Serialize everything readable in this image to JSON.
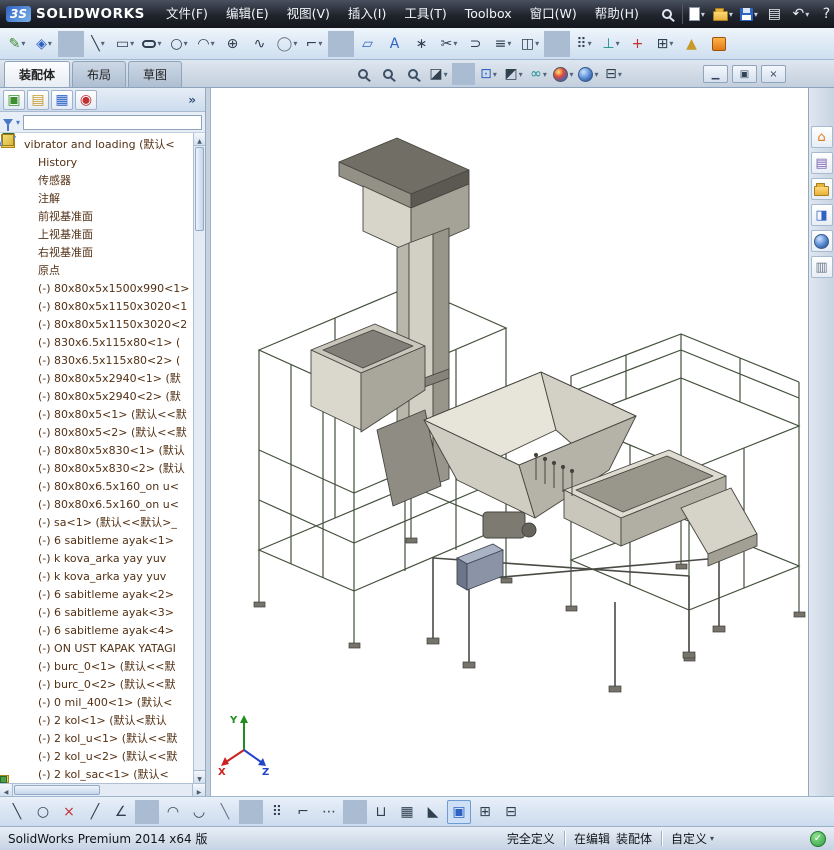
{
  "titlebar": {
    "logo_mark": "3S",
    "logo": "SOLIDWORKS",
    "menus": [
      {
        "label": "文件(F)"
      },
      {
        "label": "编辑(E)"
      },
      {
        "label": "视图(V)"
      },
      {
        "label": "插入(I)"
      },
      {
        "label": "工具(T)"
      },
      {
        "label": "Toolbox"
      },
      {
        "label": "窗口(W)"
      },
      {
        "label": "帮助(H)"
      }
    ],
    "icons": [
      {
        "name": "search-icon",
        "cls": "c-mag",
        "glyph": ""
      },
      {
        "name": "titlebar-separator",
        "cls": "c-sep",
        "glyph": ""
      },
      {
        "name": "new-document-icon",
        "cls": "c-new",
        "glyph": "",
        "dd": "▾"
      },
      {
        "name": "open-icon",
        "cls": "c-folder",
        "glyph": "",
        "dd": "▾"
      },
      {
        "name": "save-icon",
        "cls": "c-save",
        "glyph": "",
        "dd": "▾"
      },
      {
        "name": "print-icon",
        "cls": "g-light",
        "glyph": "▤"
      },
      {
        "name": "undo-icon",
        "cls": "g-light",
        "glyph": "↶",
        "dd": "▾"
      },
      {
        "name": "help-icon",
        "cls": "g-light",
        "glyph": "?"
      },
      {
        "name": "switch-windows-icon",
        "cls": "g-light",
        "glyph": "▣"
      },
      {
        "name": "fullscreen-icon",
        "cls": "g-light",
        "glyph": "⊞"
      },
      {
        "name": "options-icon",
        "cls": "c-orange",
        "glyph": ""
      }
    ]
  },
  "toolbar_sketch": {
    "icons": [
      {
        "name": "edit-sketch-icon",
        "cls": "g-green",
        "glyph": "✎",
        "dd": "▾"
      },
      {
        "name": "smart-dimension-icon",
        "cls": "g-blue",
        "glyph": "◈",
        "dd": "▾"
      },
      {
        "name": "toolbar-separator",
        "cls": "c-sep",
        "glyph": ""
      },
      {
        "name": "line-icon",
        "cls": "g-dark",
        "glyph": "╲",
        "dd": "▾"
      },
      {
        "name": "rectangle-icon",
        "cls": "g-dark",
        "glyph": "▭",
        "dd": "▾"
      },
      {
        "name": "slot-icon",
        "cls": "c-pill",
        "glyph": "",
        "dd": "▾"
      },
      {
        "name": "circle-icon",
        "cls": "g-dark",
        "glyph": "○",
        "dd": "▾"
      },
      {
        "name": "arc-icon",
        "cls": "g-dark",
        "glyph": "◠",
        "dd": "▾"
      },
      {
        "name": "perimeter-circle-icon",
        "cls": "g-dark",
        "glyph": "⊕"
      },
      {
        "name": "spline-icon",
        "cls": "g-dark",
        "glyph": "∿"
      },
      {
        "name": "ellipse-icon",
        "cls": "g-gray",
        "glyph": "◯",
        "dd": "▾"
      },
      {
        "name": "fillet-icon",
        "cls": "g-dark",
        "glyph": "⌐",
        "dd": "▾"
      },
      {
        "name": "toolbar-separator",
        "cls": "c-sep",
        "glyph": ""
      },
      {
        "name": "plane-icon",
        "cls": "g-blue",
        "glyph": "▱"
      },
      {
        "name": "text-icon",
        "cls": "g-blue",
        "glyph": "A"
      },
      {
        "name": "point-icon",
        "cls": "g-dark",
        "glyph": "∗"
      },
      {
        "name": "trim-entities-icon",
        "cls": "g-dark",
        "glyph": "✂",
        "dd": "▾"
      },
      {
        "name": "convert-entities-icon",
        "cls": "g-dark",
        "glyph": "⊃"
      },
      {
        "name": "offset-entities-icon",
        "cls": "g-dark",
        "glyph": "≡",
        "dd": "▾"
      },
      {
        "name": "mirror-entities-icon",
        "cls": "g-dark",
        "glyph": "◫",
        "dd": "▾"
      },
      {
        "name": "toolbar-separator",
        "cls": "c-sep",
        "glyph": ""
      },
      {
        "name": "linear-pattern-icon",
        "cls": "g-dark",
        "glyph": "⠿",
        "dd": "▾"
      },
      {
        "name": "display-relations-icon",
        "cls": "g-teal",
        "glyph": "⊥",
        "dd": "▾"
      },
      {
        "name": "repair-sketch-icon",
        "cls": "g-red",
        "glyph": "+"
      },
      {
        "name": "quick-snaps-icon",
        "cls": "g-dark",
        "glyph": "⊞",
        "dd": "▾"
      },
      {
        "name": "rapid-sketch-icon",
        "cls": "g-gold",
        "glyph": "▲"
      },
      {
        "name": "sketch-options-icon",
        "cls": "c-orange",
        "glyph": ""
      }
    ]
  },
  "tabs": {
    "items": [
      {
        "label": "装配体",
        "state": "active"
      },
      {
        "label": "布局",
        "state": ""
      },
      {
        "label": "草图",
        "state": ""
      }
    ]
  },
  "headsup": {
    "icons": [
      {
        "name": "zoom-fit-icon",
        "cls": "c-mag",
        "glyph": ""
      },
      {
        "name": "zoom-area-icon",
        "cls": "c-mag",
        "glyph": ""
      },
      {
        "name": "previous-view-icon",
        "cls": "c-mag",
        "glyph": ""
      },
      {
        "name": "section-view-icon",
        "cls": "g-dark",
        "glyph": "◪",
        "dd": "▾"
      },
      {
        "name": "headsup-separator",
        "cls": "c-sep",
        "glyph": ""
      },
      {
        "name": "view-orientation-icon",
        "cls": "g-blue",
        "glyph": "⊡",
        "dd": "▾"
      },
      {
        "name": "display-style-icon",
        "cls": "g-dark",
        "glyph": "◩",
        "dd": "▾"
      },
      {
        "name": "hide-show-items-icon",
        "cls": "g-teal",
        "glyph": "∞",
        "dd": "▾"
      },
      {
        "name": "edit-appearance-icon",
        "cls": "c-ball",
        "glyph": "",
        "dd": "▾"
      },
      {
        "name": "apply-scene-icon",
        "cls": "c-ball2",
        "glyph": "",
        "dd": "▾"
      },
      {
        "name": "view-settings-icon",
        "cls": "g-dark",
        "glyph": "⊟",
        "dd": "▾"
      }
    ]
  },
  "window_controls": [
    {
      "name": "minimize-button",
      "glyph": "▁"
    },
    {
      "name": "restore-button",
      "glyph": "▣"
    },
    {
      "name": "close-button",
      "glyph": "×"
    }
  ],
  "panel_tabs": {
    "icons": [
      {
        "name": "featuremanager-tab-icon",
        "cls": "g-green",
        "glyph": "▣"
      },
      {
        "name": "propertymanager-tab-icon",
        "cls": "g-gold",
        "glyph": "▤"
      },
      {
        "name": "configurationmanager-tab-icon",
        "cls": "g-blue",
        "glyph": "▦"
      },
      {
        "name": "displaymanager-tab-icon",
        "cls": "g-red",
        "glyph": "◉"
      }
    ],
    "overflow": "»"
  },
  "filter": {
    "caret": "▾"
  },
  "tree": {
    "items": [
      {
        "icon": "i-root",
        "icon_name": "assembly-icon",
        "lvl": "lvl0",
        "label": "vibrator and loading (默认<"
      },
      {
        "icon": "i-history",
        "icon_name": "history-folder-icon",
        "lvl": "lvl1",
        "label": "History"
      },
      {
        "icon": "i-sensor",
        "icon_name": "sensors-icon",
        "lvl": "lvl1",
        "label": "传感器"
      },
      {
        "icon": "i-anno",
        "icon_name": "annotations-icon",
        "lvl": "lvl1",
        "label": "注解"
      },
      {
        "icon": "i-plane",
        "icon_name": "plane-icon",
        "lvl": "lvl1",
        "label": "前视基准面"
      },
      {
        "icon": "i-plane",
        "icon_name": "plane-icon",
        "lvl": "lvl1",
        "label": "上视基准面"
      },
      {
        "icon": "i-plane",
        "icon_name": "plane-icon",
        "lvl": "lvl1",
        "label": "右视基准面"
      },
      {
        "icon": "i-origin",
        "icon_name": "origin-icon",
        "lvl": "lvl1",
        "label": "原点"
      },
      {
        "icon": "i-part",
        "icon_name": "part-icon",
        "lvl": "lvl1",
        "label": "(-) 80x80x5x1500x990<1> (默"
      },
      {
        "icon": "i-part",
        "icon_name": "part-icon",
        "lvl": "lvl1",
        "label": "(-) 80x80x5x1150x3020<1"
      },
      {
        "icon": "i-part",
        "icon_name": "part-icon",
        "lvl": "lvl1",
        "label": "(-) 80x80x5x1150x3020<2"
      },
      {
        "icon": "i-part",
        "icon_name": "part-icon",
        "lvl": "lvl1",
        "label": "(-) 830x6.5x115x80<1> ("
      },
      {
        "icon": "i-part",
        "icon_name": "part-icon",
        "lvl": "lvl1",
        "label": "(-) 830x6.5x115x80<2> ("
      },
      {
        "icon": "i-part",
        "icon_name": "part-icon",
        "lvl": "lvl1",
        "label": "(-) 80x80x5x2940<1> (默"
      },
      {
        "icon": "i-part",
        "icon_name": "part-icon",
        "lvl": "lvl1",
        "label": "(-) 80x80x5x2940<2> (默"
      },
      {
        "icon": "i-part",
        "icon_name": "part-icon",
        "lvl": "lvl1",
        "label": "(-) 80x80x5<1> (默认<<默"
      },
      {
        "icon": "i-part",
        "icon_name": "part-icon",
        "lvl": "lvl1",
        "label": "(-) 80x80x5<2> (默认<<默"
      },
      {
        "icon": "i-part",
        "icon_name": "part-icon",
        "lvl": "lvl1",
        "label": "(-) 80x80x5x830<1> (默认"
      },
      {
        "icon": "i-part",
        "icon_name": "part-icon",
        "lvl": "lvl1",
        "label": "(-) 80x80x5x830<2> (默认"
      },
      {
        "icon": "i-part",
        "icon_name": "part-icon",
        "lvl": "lvl1",
        "label": "(-) 80x80x6.5x160_on u<"
      },
      {
        "icon": "i-part",
        "icon_name": "part-icon",
        "lvl": "lvl1",
        "label": "(-) 80x80x6.5x160_on u<"
      },
      {
        "icon": "i-part",
        "icon_name": "part-icon",
        "lvl": "lvl1",
        "label": "(-) sa<1> (默认<<默认>_"
      },
      {
        "icon": "i-part",
        "icon_name": "part-icon",
        "lvl": "lvl1",
        "label": "(-) 6 sabitleme ayak<1>"
      },
      {
        "icon": "i-part",
        "icon_name": "part-icon",
        "lvl": "lvl1",
        "label": "(-) k kova_arka yay yuv"
      },
      {
        "icon": "i-part",
        "icon_name": "part-icon",
        "lvl": "lvl1",
        "label": "(-) k kova_arka yay yuv"
      },
      {
        "icon": "i-part",
        "icon_name": "part-icon",
        "lvl": "lvl1",
        "label": "(-) 6 sabitleme ayak<2>"
      },
      {
        "icon": "i-part",
        "icon_name": "part-icon",
        "lvl": "lvl1",
        "label": "(-) 6 sabitleme ayak<3>"
      },
      {
        "icon": "i-part",
        "icon_name": "part-icon",
        "lvl": "lvl1",
        "label": "(-) 6 sabitleme ayak<4>"
      },
      {
        "icon": "i-part",
        "icon_name": "part-icon",
        "lvl": "lvl1",
        "label": "(-) ON UST KAPAK YATAGI"
      },
      {
        "icon": "i-part",
        "icon_name": "part-icon",
        "lvl": "lvl1",
        "label": "(-) burc_0<1> (默认<<默"
      },
      {
        "icon": "i-part",
        "icon_name": "part-icon",
        "lvl": "lvl1",
        "label": "(-) burc_0<2> (默认<<默"
      },
      {
        "icon": "i-part",
        "icon_name": "part-icon",
        "lvl": "lvl1",
        "label": "(-) 0 mil_400<1> (默认<"
      },
      {
        "icon": "i-part",
        "icon_name": "part-icon",
        "lvl": "lvl1",
        "label": "(-) 2 kol<1> (默认<默认"
      },
      {
        "icon": "i-part",
        "icon_name": "part-icon",
        "lvl": "lvl1",
        "label": "(-) 2 kol_u<1> (默认<<默"
      },
      {
        "icon": "i-part",
        "icon_name": "part-icon",
        "lvl": "lvl1",
        "label": "(-) 2 kol_u<2> (默认<<默"
      },
      {
        "icon": "i-part",
        "icon_name": "part-icon",
        "lvl": "lvl1",
        "label": "(-) 2 kol_sac<1> (默认<"
      }
    ]
  },
  "task_pane": {
    "icons": [
      {
        "name": "resources-icon",
        "cls": "g-orange",
        "glyph": "⌂"
      },
      {
        "name": "design-library-icon",
        "cls": "g-purple",
        "glyph": "▤"
      },
      {
        "name": "file-explorer-icon",
        "cls": "c-folder",
        "glyph": ""
      },
      {
        "name": "view-palette-icon",
        "cls": "g-blue",
        "glyph": "◨"
      },
      {
        "name": "appearances-icon",
        "cls": "c-ball2",
        "glyph": ""
      },
      {
        "name": "custom-properties-icon",
        "cls": "g-gray",
        "glyph": "▥"
      }
    ]
  },
  "toolbar_bottom": {
    "icons": [
      {
        "name": "sketch-line-icon",
        "cls": "g-dark",
        "glyph": "╲"
      },
      {
        "name": "sketch-circle-icon",
        "cls": "g-dark",
        "glyph": "○"
      },
      {
        "name": "delete-relation-icon",
        "cls": "g-red",
        "glyph": "×"
      },
      {
        "name": "sketch-diagonal-icon",
        "cls": "g-dark",
        "glyph": "╱"
      },
      {
        "name": "angle-dimension-icon",
        "cls": "g-dark",
        "glyph": "∠"
      },
      {
        "name": "bottombar-separator",
        "cls": "c-sep",
        "glyph": ""
      },
      {
        "name": "arc-tool-icon",
        "cls": "g-dark",
        "glyph": "◠"
      },
      {
        "name": "chord-tool-icon",
        "cls": "g-dark",
        "glyph": "◡"
      },
      {
        "name": "centerline-icon",
        "cls": "g-gray",
        "glyph": "╲"
      },
      {
        "name": "bottombar-separator",
        "cls": "c-sep",
        "glyph": ""
      },
      {
        "name": "snap-points-icon",
        "cls": "g-dark",
        "glyph": "⠿"
      },
      {
        "name": "corner-snap-icon",
        "cls": "g-dark",
        "glyph": "⌐"
      },
      {
        "name": "more-snaps-icon",
        "cls": "g-dark",
        "glyph": "⋯"
      },
      {
        "name": "bottombar-separator",
        "cls": "c-sep",
        "glyph": ""
      },
      {
        "name": "relief-icon",
        "cls": "g-dark",
        "glyph": "⊔"
      },
      {
        "name": "grid-icon",
        "cls": "g-dark",
        "glyph": "▦"
      },
      {
        "name": "section-triangle-icon",
        "cls": "g-dark",
        "glyph": "◣"
      },
      {
        "name": "shaded-contours-icon",
        "cls": "g-blue",
        "glyph": "▣",
        "state": "pressed"
      },
      {
        "name": "viewport-split-icon",
        "cls": "g-dark",
        "glyph": "⊞"
      },
      {
        "name": "viewport-single-icon",
        "cls": "g-dark",
        "glyph": "⊟"
      }
    ]
  },
  "statusbar": {
    "app": "SolidWorks Premium 2014 x64 版",
    "defined": "完全定义",
    "editing": "在编辑",
    "doc": "装配体",
    "custom": "自定义",
    "caret": "▾",
    "ok": "✓"
  },
  "triad": {
    "x": "X",
    "y": "Y",
    "z": "Z"
  }
}
